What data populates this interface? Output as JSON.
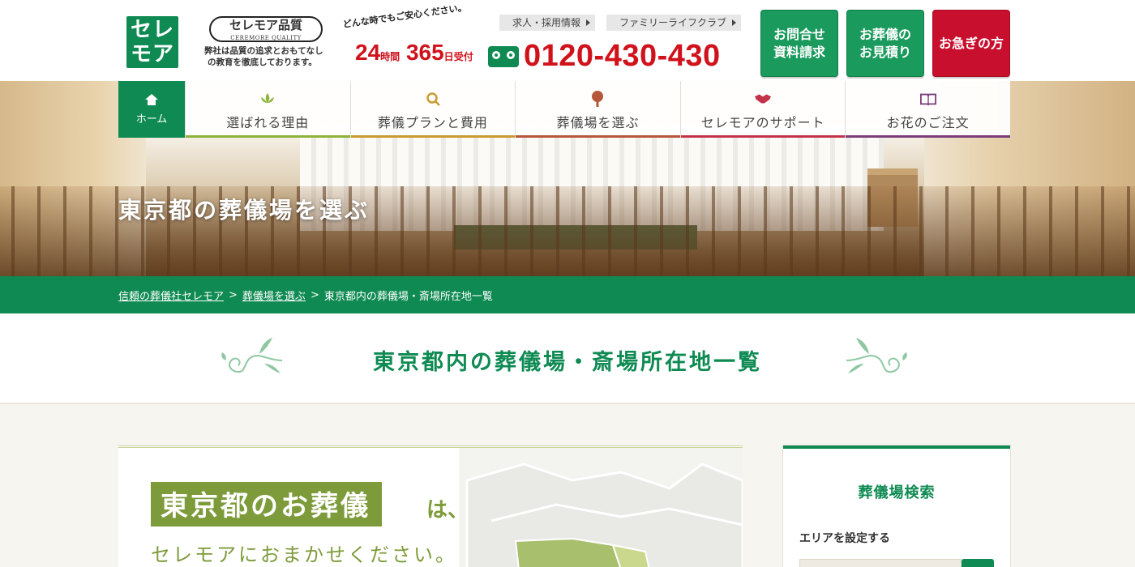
{
  "header": {
    "logo_top": "セレ",
    "logo_bottom": "モア",
    "quality_title": "セレモア品質",
    "quality_sub": "CEREMORE QUALITY",
    "quality_text_1": "弊社は品質の追求とおもてなし",
    "quality_text_2": "の教育を徹底しております。",
    "anytime_top": "どんな時でもご安心ください。",
    "anytime_24": "24",
    "anytime_hours": "時間",
    "anytime_365": "365",
    "anytime_days": "日",
    "anytime_accept": "受付",
    "link_recruit": "求人・採用情報",
    "link_family": "ファミリーライフクラブ",
    "phone": "0120-430-430",
    "cta_inquiry": [
      "お問合せ",
      "資料請求"
    ],
    "cta_estimate": [
      "お葬儀の",
      "お見積り"
    ],
    "cta_urgent": "お急ぎの方"
  },
  "nav": {
    "home": "ホーム",
    "items": [
      {
        "label": "選ばれる理由",
        "icon": "lotus-icon",
        "color": "#8db33b"
      },
      {
        "label": "葬儀プランと費用",
        "icon": "search-coin-icon",
        "color": "#c99a2e"
      },
      {
        "label": "葬儀場を選ぶ",
        "icon": "tree-icon",
        "color": "#b5583a"
      },
      {
        "label": "セレモアのサポート",
        "icon": "handshake-icon",
        "color": "#c2334a"
      },
      {
        "label": "お花のご注文",
        "icon": "book-icon",
        "color": "#7a3d7a"
      }
    ]
  },
  "hero": {
    "title": "東京都の葬儀場を選ぶ"
  },
  "breadcrumb": {
    "home": "信頼の葬儀社セレモア",
    "sep1": ">",
    "parent": "葬儀場を選ぶ",
    "sep2": ">",
    "current": "東京都内の葬儀場・斎場所在地一覧"
  },
  "page": {
    "heading": "東京都内の葬儀場・斎場所在地一覧"
  },
  "main": {
    "tokyo_label": "東京都のお葬儀",
    "tokyo_ha": "は、",
    "tokyo_sub": "セレモアにおまかせください。"
  },
  "sidebar": {
    "title": "葬儀場検索",
    "area_label": "エリアを設定する"
  },
  "colors": {
    "brand_green": "#0e8a52",
    "urgent_red": "#c8102e",
    "phone_red": "#d0121b",
    "olive": "#7d9b3a"
  }
}
